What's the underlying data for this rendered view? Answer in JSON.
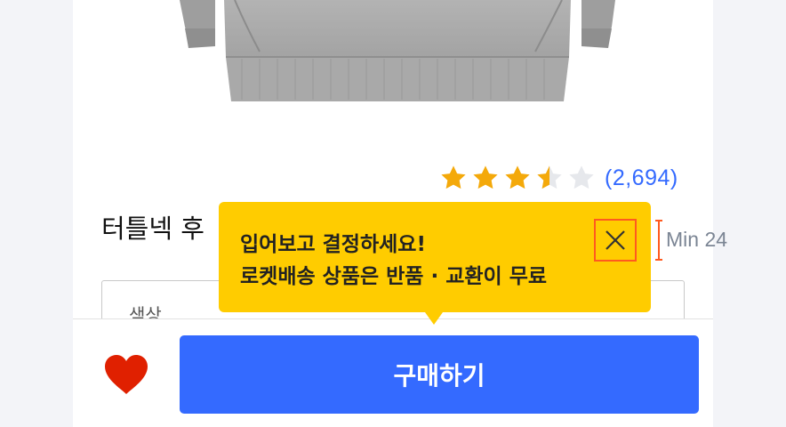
{
  "product": {
    "title": "터틀넥 후",
    "rating": {
      "stars": 3.5,
      "max_stars": 5,
      "count_text": "(2,694)"
    },
    "option": {
      "label": "색상"
    }
  },
  "tooltip": {
    "line1": "입어보고 결정하세요!",
    "line2": "로켓배송 상품은 반품 · 교환이 무료"
  },
  "bottom_bar": {
    "buy_label": "구매하기"
  },
  "annotation": {
    "min_label": "Min 24"
  },
  "colors": {
    "accent_blue": "#346aff",
    "star_gold": "#f4a90a",
    "star_empty": "#e6e8ec",
    "tooltip_yellow": "#ffcc00",
    "heart_red": "#e02000",
    "highlight_orange": "#ff5a1f"
  },
  "icons": {
    "wishlist": "heart-icon",
    "close": "close-icon",
    "rating": "star-icon"
  }
}
